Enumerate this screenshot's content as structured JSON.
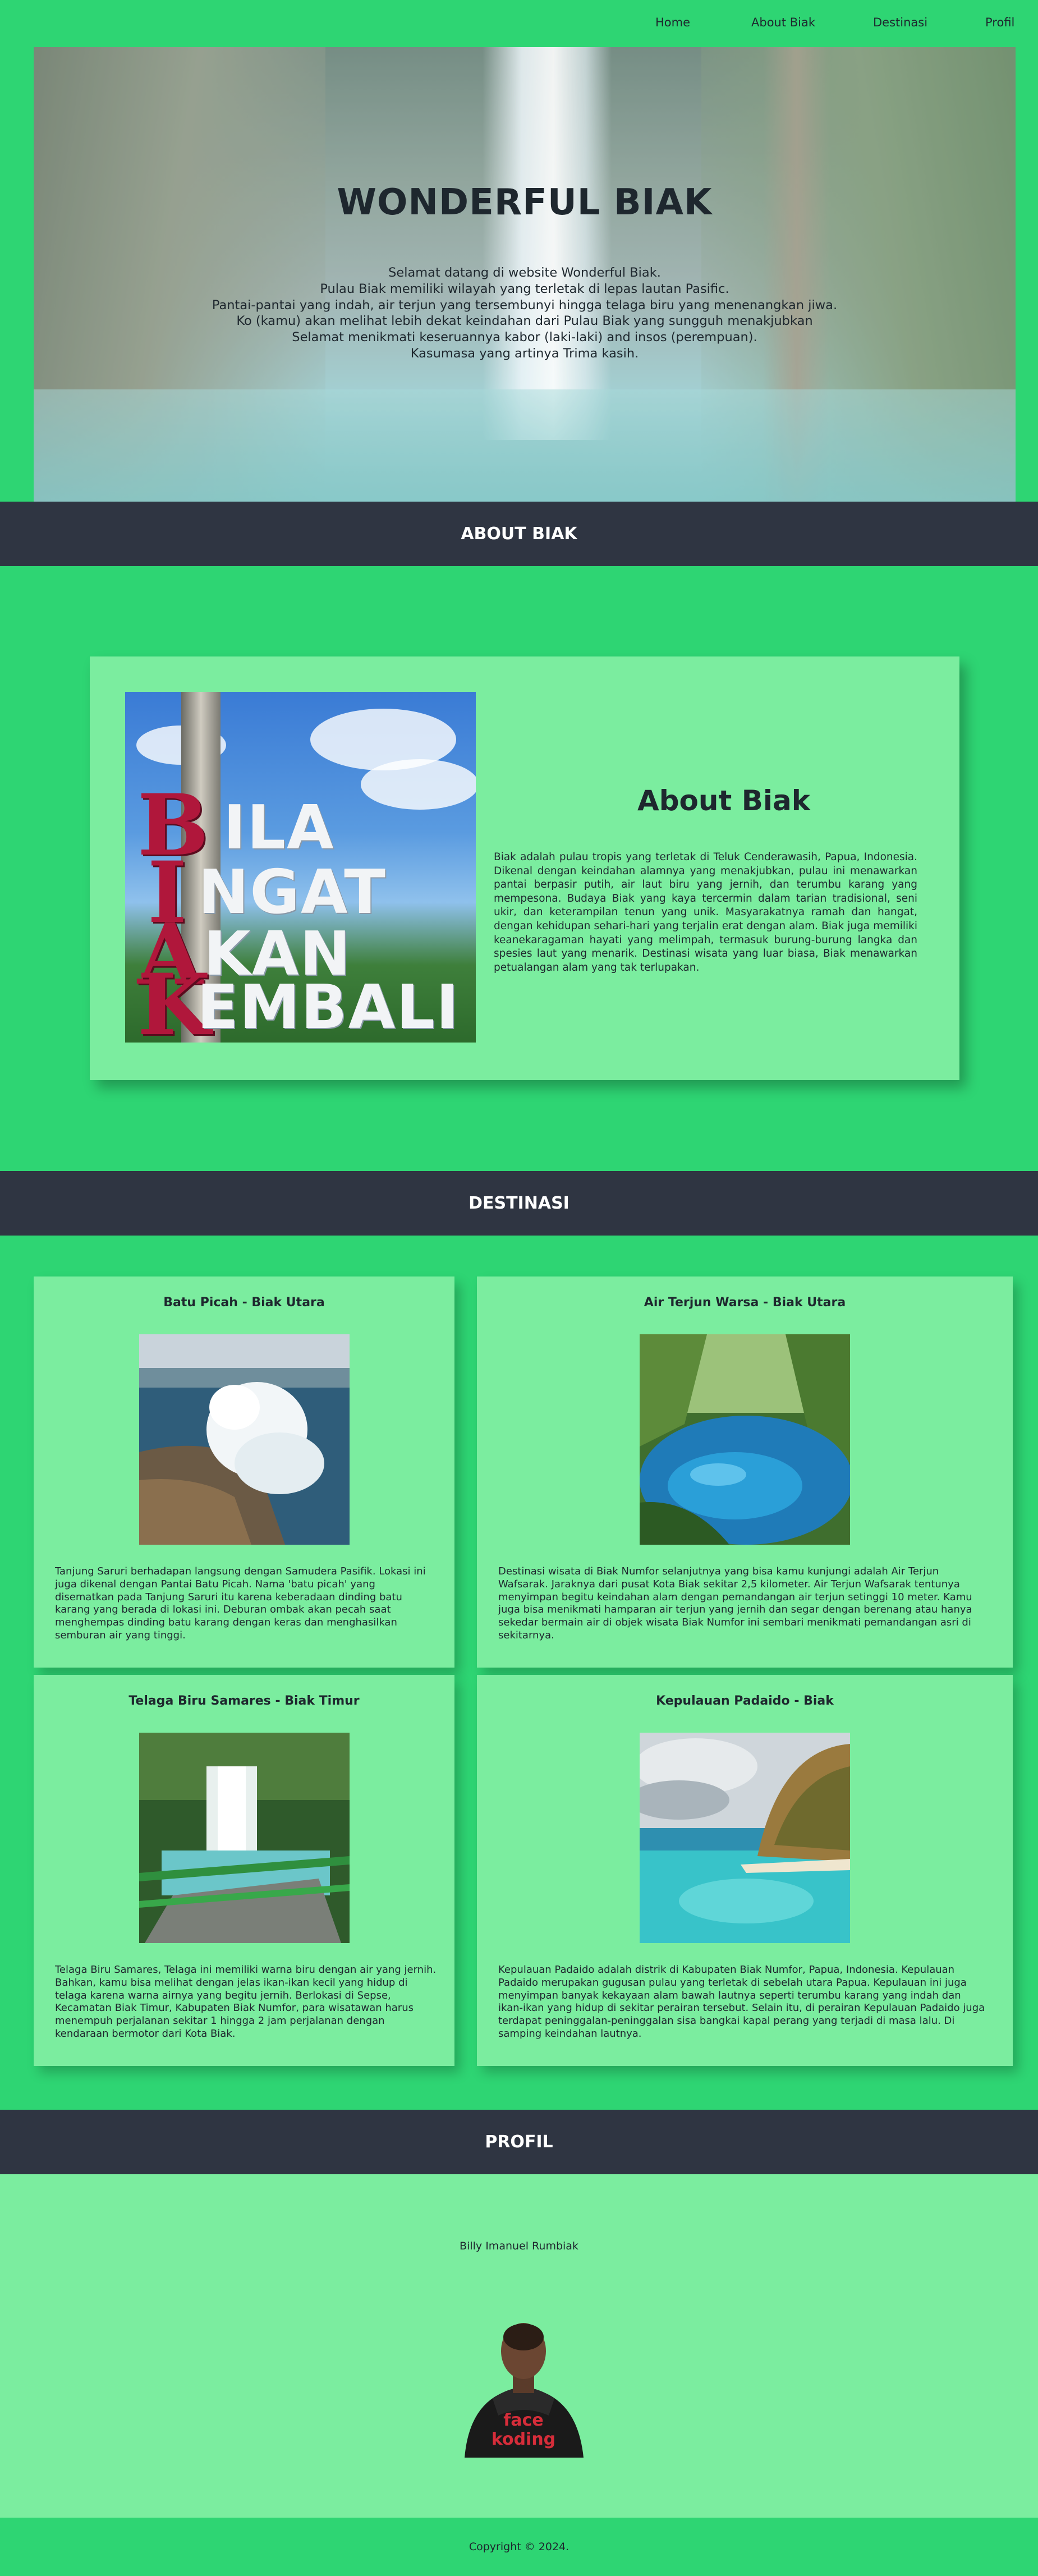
{
  "nav": {
    "items": [
      {
        "label": "Home"
      },
      {
        "label": "About Biak"
      },
      {
        "label": "Destinasi"
      },
      {
        "label": "Profil"
      }
    ]
  },
  "hero": {
    "title": "WONDERFUL BIAK",
    "lines": [
      "Selamat datang di website Wonderful Biak.",
      "Pulau Biak memiliki wilayah yang terletak di lepas lautan Pasific.",
      "Pantai-pantai yang indah, air terjun yang tersembunyi hingga telaga biru yang menenangkan jiwa.",
      "Ko (kamu) akan melihat lebih dekat keindahan dari Pulau Biak yang sungguh menakjubkan",
      "Selamat menikmati keseruannya kabor (laki-laki) and insos (perempuan).",
      "Kasumasa yang artinya Trima kasih."
    ]
  },
  "about": {
    "band_title": "ABOUT BIAK",
    "heading": "About Biak",
    "text": "Biak adalah pulau tropis yang terletak di Teluk Cenderawasih, Papua, Indonesia. Dikenal dengan keindahan alamnya yang menakjubkan, pulau ini menawarkan pantai berpasir putih, air laut biru yang jernih, dan terumbu karang yang mempesona. Budaya Biak yang kaya tercermin dalam tarian tradisional, seni ukir, dan keterampilan tenun yang unik. Masyarakatnya ramah dan hangat, dengan kehidupan sehari-hari yang terjalin erat dengan alam. Biak juga memiliki keanekaragaman hayati yang melimpah, termasuk burung-burung langka dan spesies laut yang menarik. Destinasi wisata yang luar biasa, Biak menawarkan petualangan alam yang tak terlupakan.",
    "sign": {
      "red_letters": [
        "B",
        "I",
        "A",
        "K"
      ],
      "white_words": [
        "ILA",
        "NGAT",
        "KAN",
        "EMBALI"
      ]
    }
  },
  "destinasi": {
    "band_title": "DESTINASI",
    "cards": [
      {
        "title": "Batu Picah - Biak Utara",
        "text": "Tanjung Saruri berhadapan langsung dengan Samudera Pasifik. Lokasi ini juga dikenal dengan Pantai Batu Picah. Nama 'batu picah' yang disematkan pada Tanjung Saruri itu karena keberadaan dinding batu karang yang berada di lokasi ini. Deburan ombak akan pecah saat menghempas dinding batu karang dengan keras dan menghasilkan semburan air yang tinggi."
      },
      {
        "title": "Air Terjun Warsa - Biak Utara",
        "text": "Destinasi wisata di Biak Numfor selanjutnya yang bisa kamu kunjungi adalah Air Terjun Wafsarak. Jaraknya dari pusat Kota Biak sekitar 2,5 kilometer. Air Terjun Wafsarak tentunya menyimpan begitu keindahan alam dengan pemandangan air terjun setinggi 10 meter. Kamu juga bisa menikmati hamparan air terjun yang jernih dan segar dengan berenang atau hanya sekedar bermain air di objek wisata Biak Numfor ini sembari menikmati pemandangan asri di sekitarnya."
      },
      {
        "title": "Telaga Biru Samares - Biak Timur",
        "text": "Telaga Biru Samares, Telaga ini memiliki warna biru dengan air yang jernih. Bahkan, kamu bisa melihat dengan jelas ikan-ikan kecil yang hidup di telaga karena warna airnya yang begitu jernih. Berlokasi di Sepse, Kecamatan Biak Timur, Kabupaten Biak Numfor, para wisatawan harus menempuh perjalanan sekitar 1 hingga 2 jam perjalanan dengan kendaraan bermotor dari Kota Biak."
      },
      {
        "title": "Kepulauan Padaido - Biak",
        "text": "Kepulauan Padaido adalah distrik di Kabupaten Biak Numfor, Papua, Indonesia. Kepulauan Padaido merupakan gugusan pulau yang terletak di sebelah utara Papua. Kepulauan ini juga menyimpan banyak kekayaan alam bawah lautnya seperti terumbu karang yang indah dan ikan-ikan yang hidup di sekitar perairan tersebut. Selain itu, di perairan Kepulauan Padaido juga terdapat peninggalan-peninggalan sisa bangkai kapal perang yang terjadi di masa lalu. Di samping keindahan lautnya."
      }
    ]
  },
  "profil": {
    "band_title": "PROFIL",
    "name": "Billy Imanuel Rumbiak",
    "shirt_text": [
      "face",
      "koding"
    ]
  },
  "footer": {
    "copyright": "Copyright © 2024."
  }
}
